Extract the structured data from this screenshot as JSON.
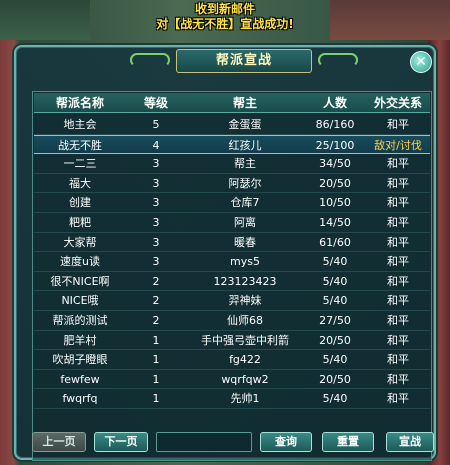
{
  "notice": {
    "line1": "收到新邮件",
    "line2": "对【战无不胜】宣战成功!"
  },
  "panel": {
    "title": "帮派宣战",
    "close_glyph": "✕"
  },
  "table": {
    "headers": [
      "帮派名称",
      "等级",
      "帮主",
      "人数",
      "外交关系"
    ],
    "rows": [
      {
        "name": "地主会",
        "level": "5",
        "leader": "金蛋蛋",
        "members": "86/160",
        "relation": "和平"
      },
      {
        "name": "战无不胜",
        "level": "4",
        "leader": "红孩儿",
        "members": "25/100",
        "relation": "敌对/讨伐"
      },
      {
        "name": "一二三",
        "level": "3",
        "leader": "帮主",
        "members": "34/50",
        "relation": "和平"
      },
      {
        "name": "福大",
        "level": "3",
        "leader": "阿瑟尔",
        "members": "20/50",
        "relation": "和平"
      },
      {
        "name": "创建",
        "level": "3",
        "leader": "仓库7",
        "members": "10/50",
        "relation": "和平"
      },
      {
        "name": "粑粑",
        "level": "3",
        "leader": "阿离",
        "members": "14/50",
        "relation": "和平"
      },
      {
        "name": "大家帮",
        "level": "3",
        "leader": "暖春",
        "members": "61/60",
        "relation": "和平"
      },
      {
        "name": "速度u读",
        "level": "3",
        "leader": "mys5",
        "members": "5/40",
        "relation": "和平"
      },
      {
        "name": "很不NICE啊",
        "level": "2",
        "leader": "123123423",
        "members": "5/40",
        "relation": "和平"
      },
      {
        "name": "NICE哦",
        "level": "2",
        "leader": "羿神妹",
        "members": "5/40",
        "relation": "和平"
      },
      {
        "name": "帮派的测试",
        "level": "2",
        "leader": "仙师68",
        "members": "27/50",
        "relation": "和平"
      },
      {
        "name": "肥羊村",
        "level": "1",
        "leader": "手中强弓壶中利箭",
        "members": "20/50",
        "relation": "和平"
      },
      {
        "name": "吹胡子瞪眼",
        "level": "1",
        "leader": "fg422",
        "members": "5/40",
        "relation": "和平"
      },
      {
        "name": "fewfew",
        "level": "1",
        "leader": "wqrfqw2",
        "members": "20/50",
        "relation": "和平"
      },
      {
        "name": "fwqrfq",
        "level": "1",
        "leader": "先帅1",
        "members": "5/40",
        "relation": "和平"
      }
    ]
  },
  "footer": {
    "prev_label": "上一页",
    "next_label": "下一页",
    "page_value": "",
    "query_label": "查询",
    "reset_label": "重置",
    "declare_label": "宣战"
  }
}
